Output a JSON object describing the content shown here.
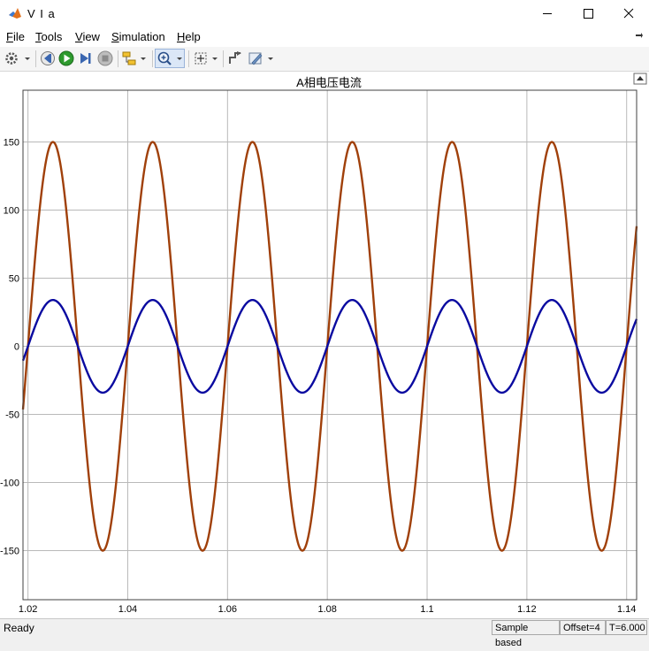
{
  "window": {
    "title": "V I a"
  },
  "menu": [
    {
      "label": "File",
      "accel": "F",
      "rest": "ile"
    },
    {
      "label": "Tools",
      "accel": "T",
      "rest": "ools"
    },
    {
      "label": "View",
      "accel": "V",
      "rest": "iew"
    },
    {
      "label": "Simulation",
      "accel": "S",
      "rest": "imulation"
    },
    {
      "label": "Help",
      "accel": "H",
      "rest": "elp"
    }
  ],
  "toolbar_icons": [
    "gear-icon",
    "step-back-icon",
    "run-icon",
    "step-forward-icon",
    "stop-icon",
    "signal-tree-icon",
    "zoom-in-icon",
    "fit-to-view-icon",
    "highlight-block-icon",
    "edit-style-icon"
  ],
  "chart_data": {
    "type": "line",
    "title": "A相电压电流",
    "xlabel": "",
    "ylabel": "",
    "xlim": [
      1.019,
      1.142
    ],
    "ylim": [
      -186,
      188
    ],
    "x_ticks": [
      "1.02",
      "1.04",
      "1.06",
      "1.08",
      "1.1",
      "1.12",
      "1.14"
    ],
    "x_tick_values": [
      1.02,
      1.04,
      1.06,
      1.08,
      1.1,
      1.12,
      1.14
    ],
    "y_ticks": [
      "150",
      "100",
      "50",
      "0",
      "-50",
      "-100",
      "-150"
    ],
    "y_tick_values": [
      150,
      100,
      50,
      0,
      -50,
      -100,
      -150
    ],
    "grid": true,
    "background": "#ffffff",
    "series": [
      {
        "color": "#a0400a",
        "amplitude": 150,
        "frequency_hz": 50,
        "phase_zero_crossing_x": 1.02,
        "x_start": 1.019,
        "x_end": 1.142
      },
      {
        "color": "#0a0aa0",
        "amplitude": 34,
        "frequency_hz": 50,
        "phase_zero_crossing_x": 1.02,
        "x_start": 1.019,
        "x_end": 1.142
      }
    ]
  },
  "status": {
    "ready": "Ready",
    "sample_mode": "Sample based",
    "offset": "Offset=4",
    "time": "T=6.000"
  }
}
